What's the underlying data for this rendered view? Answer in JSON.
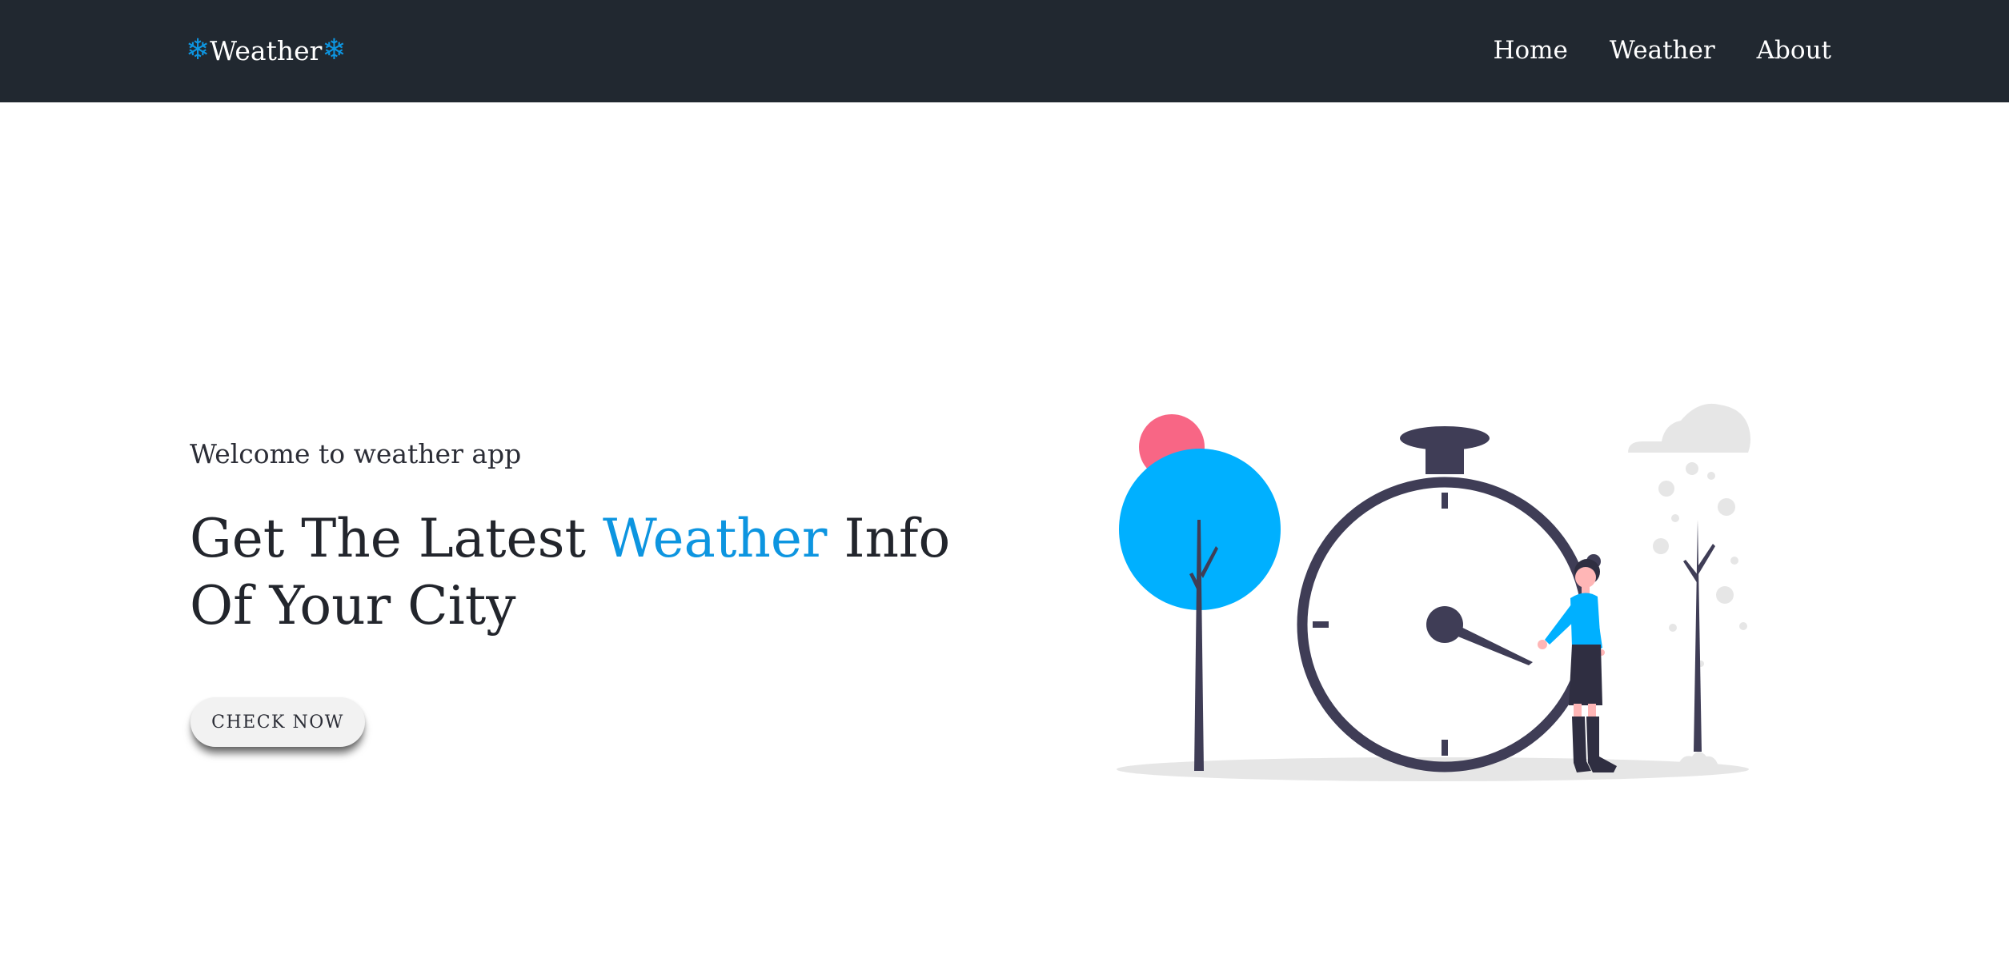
{
  "navbar": {
    "brand": {
      "icon_left": "❄",
      "text": "Weather",
      "icon_right": "❄"
    },
    "links": [
      {
        "label": "Home"
      },
      {
        "label": "Weather"
      },
      {
        "label": "About"
      }
    ]
  },
  "hero": {
    "welcome": "Welcome to weather app",
    "headline_part1": "Get The Latest ",
    "headline_accent": "Weather",
    "headline_part2": " Info Of Your City",
    "button_label": "CHECK NOW"
  },
  "illustration": {
    "icon": "person-with-clock-illustration"
  },
  "colors": {
    "navbar_bg": "#212830",
    "accent": "#0d95e0",
    "illustration_dark": "#3f3d56",
    "illustration_blue": "#00b0ff",
    "illustration_pink": "#f86685"
  }
}
